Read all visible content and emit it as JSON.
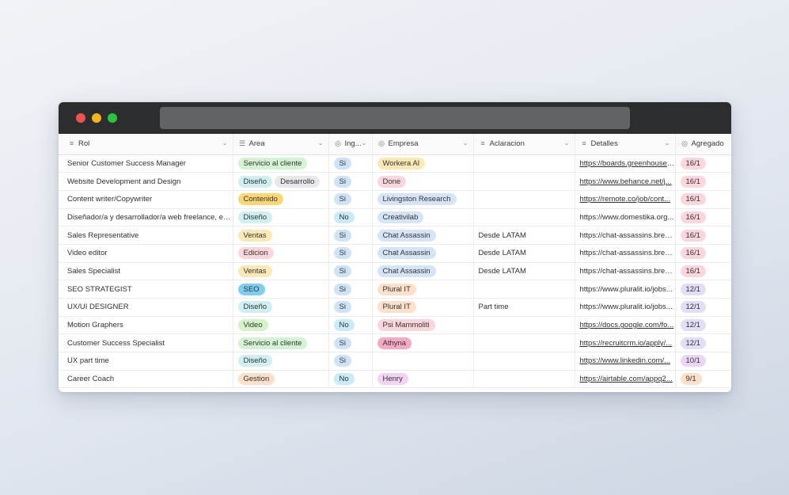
{
  "headers": {
    "rol": "Rol",
    "area": "Area",
    "ing": "Ing...",
    "empresa": "Empresa",
    "aclaracion": "Aclaracion",
    "detalles": "Detalles",
    "agregado": "Agregado"
  },
  "colors": {
    "area": {
      "Servicio al cliente": "#d4f3d2",
      "Diseño": "#cfeff0",
      "Desarrollo": "#e8e8ec",
      "Contenido": "#fbd774",
      "Ventas": "#fde9b5",
      "Edicion": "#fbd6dd",
      "SEO": "#7ccff0",
      "Video": "#d4f3c8",
      "Gestion": "#fde0c9"
    },
    "ing": {
      "Si": "#cfe3f7",
      "No": "#c9ebf7"
    },
    "empresa": {
      "Workera AI": "#fde9b5",
      "Done": "#fbd6dd",
      "Livingston Research": "#d6e4f7",
      "Creativilab": "#d6e4f7",
      "Chat Assassin": "#d6e4f7",
      "Plural IT": "#fde0c9",
      "Psi Mammoliti": "#fbd6dd",
      "Athyna": "#f6a9c2",
      "Henry": "#f3d3f3"
    },
    "agregado": {
      "16/1": "#fbd6dd",
      "12/1": "#e3ddf7",
      "10/1": "#ecd6f7",
      "9/1": "#fde0c9"
    }
  },
  "rows": [
    {
      "rol": "Senior Customer Success Manager",
      "area": [
        "Servicio al cliente"
      ],
      "ing": "Si",
      "empresa": "Workera AI",
      "aclaracion": "",
      "detalles": "https://boards.greenhouse....",
      "link": true,
      "agregado": "16/1"
    },
    {
      "rol": "Website Development and Design",
      "area": [
        "Diseño",
        "Desarrollo"
      ],
      "ing": "Si",
      "empresa": "Done",
      "aclaracion": "",
      "detalles": "https://www.behance.net/j...",
      "link": true,
      "agregado": "16/1"
    },
    {
      "rol": "Content writer/Copywriter",
      "area": [
        "Contenido"
      ],
      "ing": "Si",
      "empresa": "Livingston Research",
      "aclaracion": "",
      "detalles": "https://remote.co/job/cont...",
      "link": true,
      "agregado": "16/1"
    },
    {
      "rol": "Diseñador/a y desarrollador/a web freelance, es...",
      "area": [
        "Diseño"
      ],
      "ing": "No",
      "empresa": "Creativilab",
      "aclaracion": "",
      "detalles": "https://www.domestika.org...",
      "link": false,
      "agregado": "16/1"
    },
    {
      "rol": "Sales Representative",
      "area": [
        "Ventas"
      ],
      "ing": "Si",
      "empresa": "Chat Assassin",
      "aclaracion": "Desde LATAM",
      "detalles": "https://chat-assassins.breez...",
      "link": false,
      "agregado": "16/1"
    },
    {
      "rol": "Video editor",
      "area": [
        "Edicion"
      ],
      "ing": "Si",
      "empresa": "Chat Assassin",
      "aclaracion": "Desde LATAM",
      "detalles": "https://chat-assassins.breez...",
      "link": false,
      "agregado": "16/1"
    },
    {
      "rol": "Sales Specialist",
      "area": [
        "Ventas"
      ],
      "ing": "Si",
      "empresa": "Chat Assassin",
      "aclaracion": "Desde LATAM",
      "detalles": "https://chat-assassins.breez...",
      "link": false,
      "agregado": "16/1"
    },
    {
      "rol": "SEO STRATEGIST",
      "area": [
        "SEO"
      ],
      "ing": "Si",
      "empresa": "Plural IT",
      "aclaracion": "",
      "detalles": "https://www.pluralit.io/jobs...",
      "link": false,
      "agregado": "12/1"
    },
    {
      "rol": "UX/UI DESIGNER",
      "area": [
        "Diseño"
      ],
      "ing": "Si",
      "empresa": "Plural IT",
      "aclaracion": "Part time",
      "detalles": "https://www.pluralit.io/jobs...",
      "link": false,
      "agregado": "12/1"
    },
    {
      "rol": "Motion Graphers",
      "area": [
        "Video"
      ],
      "ing": "No",
      "empresa": "Psi Mammoliti",
      "aclaracion": "",
      "detalles": "https://docs.google.com/fo...",
      "link": true,
      "agregado": "12/1"
    },
    {
      "rol": "Customer Success Specialist",
      "area": [
        "Servicio al cliente"
      ],
      "ing": "Si",
      "empresa": "Athyna",
      "aclaracion": "",
      "detalles": "https://recruitcrm.io/apply/...",
      "link": true,
      "agregado": "12/1"
    },
    {
      "rol": "UX part time",
      "area": [
        "Diseño"
      ],
      "ing": "Si",
      "empresa": "",
      "aclaracion": "",
      "detalles": "https://www.linkedin.com/...",
      "link": true,
      "agregado": "10/1"
    },
    {
      "rol": "Career Coach",
      "area": [
        "Gestion"
      ],
      "ing": "No",
      "empresa": "Henry",
      "aclaracion": "",
      "detalles": "https://airtable.com/appq2...",
      "link": true,
      "agregado": "9/1"
    }
  ]
}
